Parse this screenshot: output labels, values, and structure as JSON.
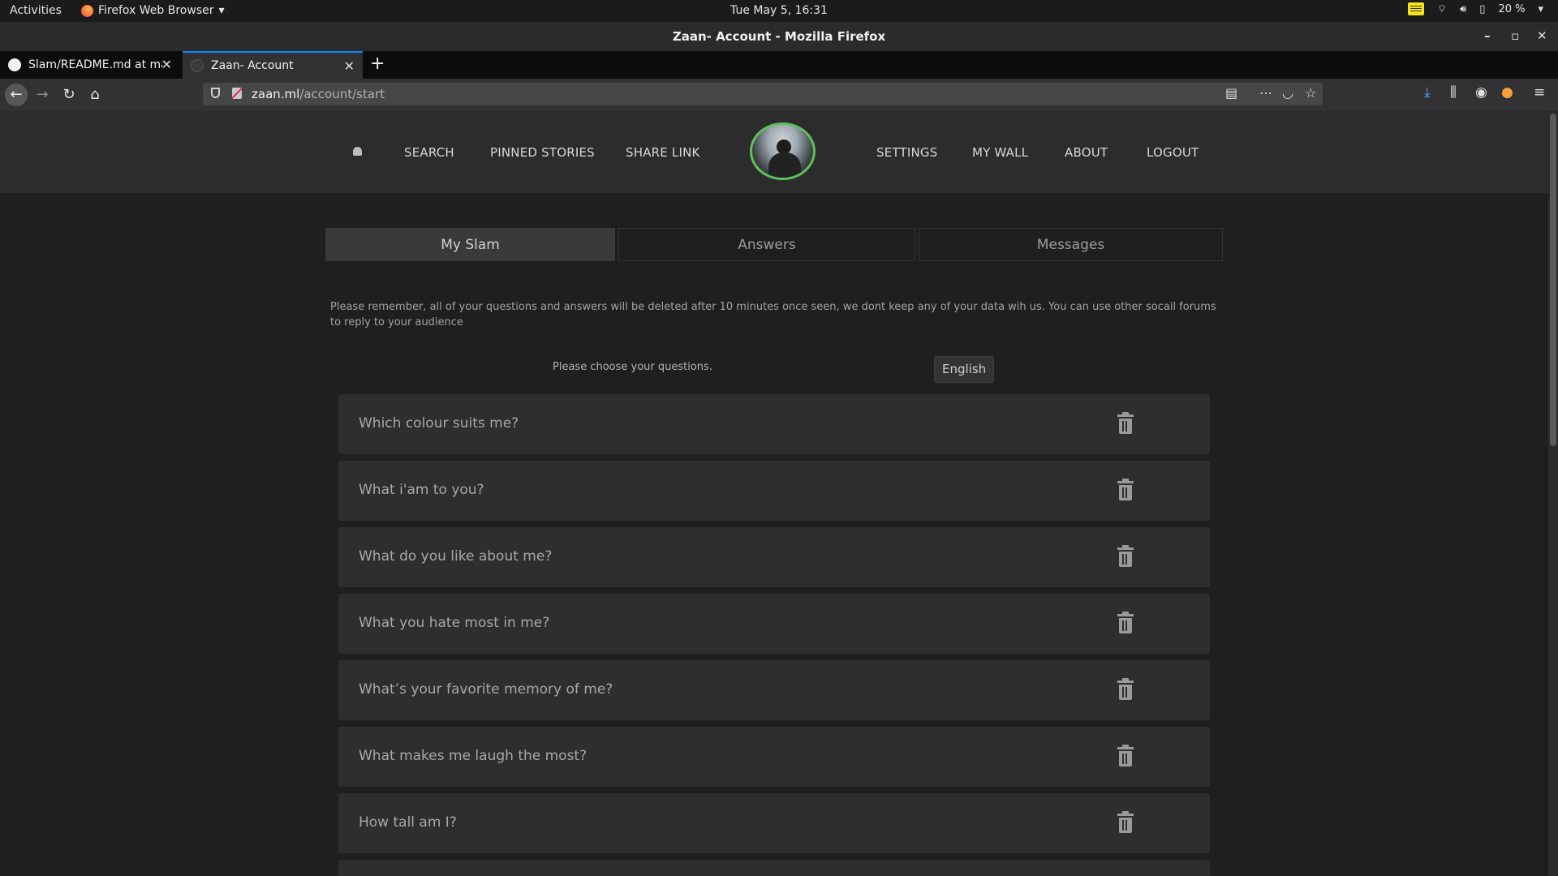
{
  "system_bar": {
    "activities": "Activities",
    "app_menu": "Firefox Web Browser",
    "clock": "Tue May  5, 16:31",
    "battery": "20 %"
  },
  "window": {
    "title": "Zaan- Account - Mozilla Firefox"
  },
  "browser": {
    "tabs": [
      {
        "label": "Slam/README.md at ma"
      },
      {
        "label": "Zaan- Account"
      }
    ],
    "url": {
      "host": "zaan.ml",
      "path": "/account/start"
    }
  },
  "site_nav": {
    "items_left": [
      "SEARCH",
      "PINNED STORIES",
      "SHARE LINK"
    ],
    "items_right": [
      "SETTINGS",
      "MY WALL",
      "ABOUT",
      "LOGOUT"
    ]
  },
  "page_tabs": [
    "My Slam",
    "Answers",
    "Messages"
  ],
  "notice": "Please remember, all of your questions and answers will be deleted after 10 minutes once seen, we dont keep any of your data wih us. You can use other socail forums to reply to your audience",
  "choose_label": "Please choose your questions.",
  "language": "English",
  "questions": [
    "Which colour suits me?",
    "What i'am to you?",
    "What do you like about me?",
    "What you hate most in me?",
    "What’s your favorite memory of me?",
    "What makes me laugh the most?",
    "How tall am I?"
  ],
  "colors": {
    "accent_tab": "#0a84ff",
    "avatar_ring": "#5cc25c",
    "page_bg": "#1f1f1f"
  }
}
